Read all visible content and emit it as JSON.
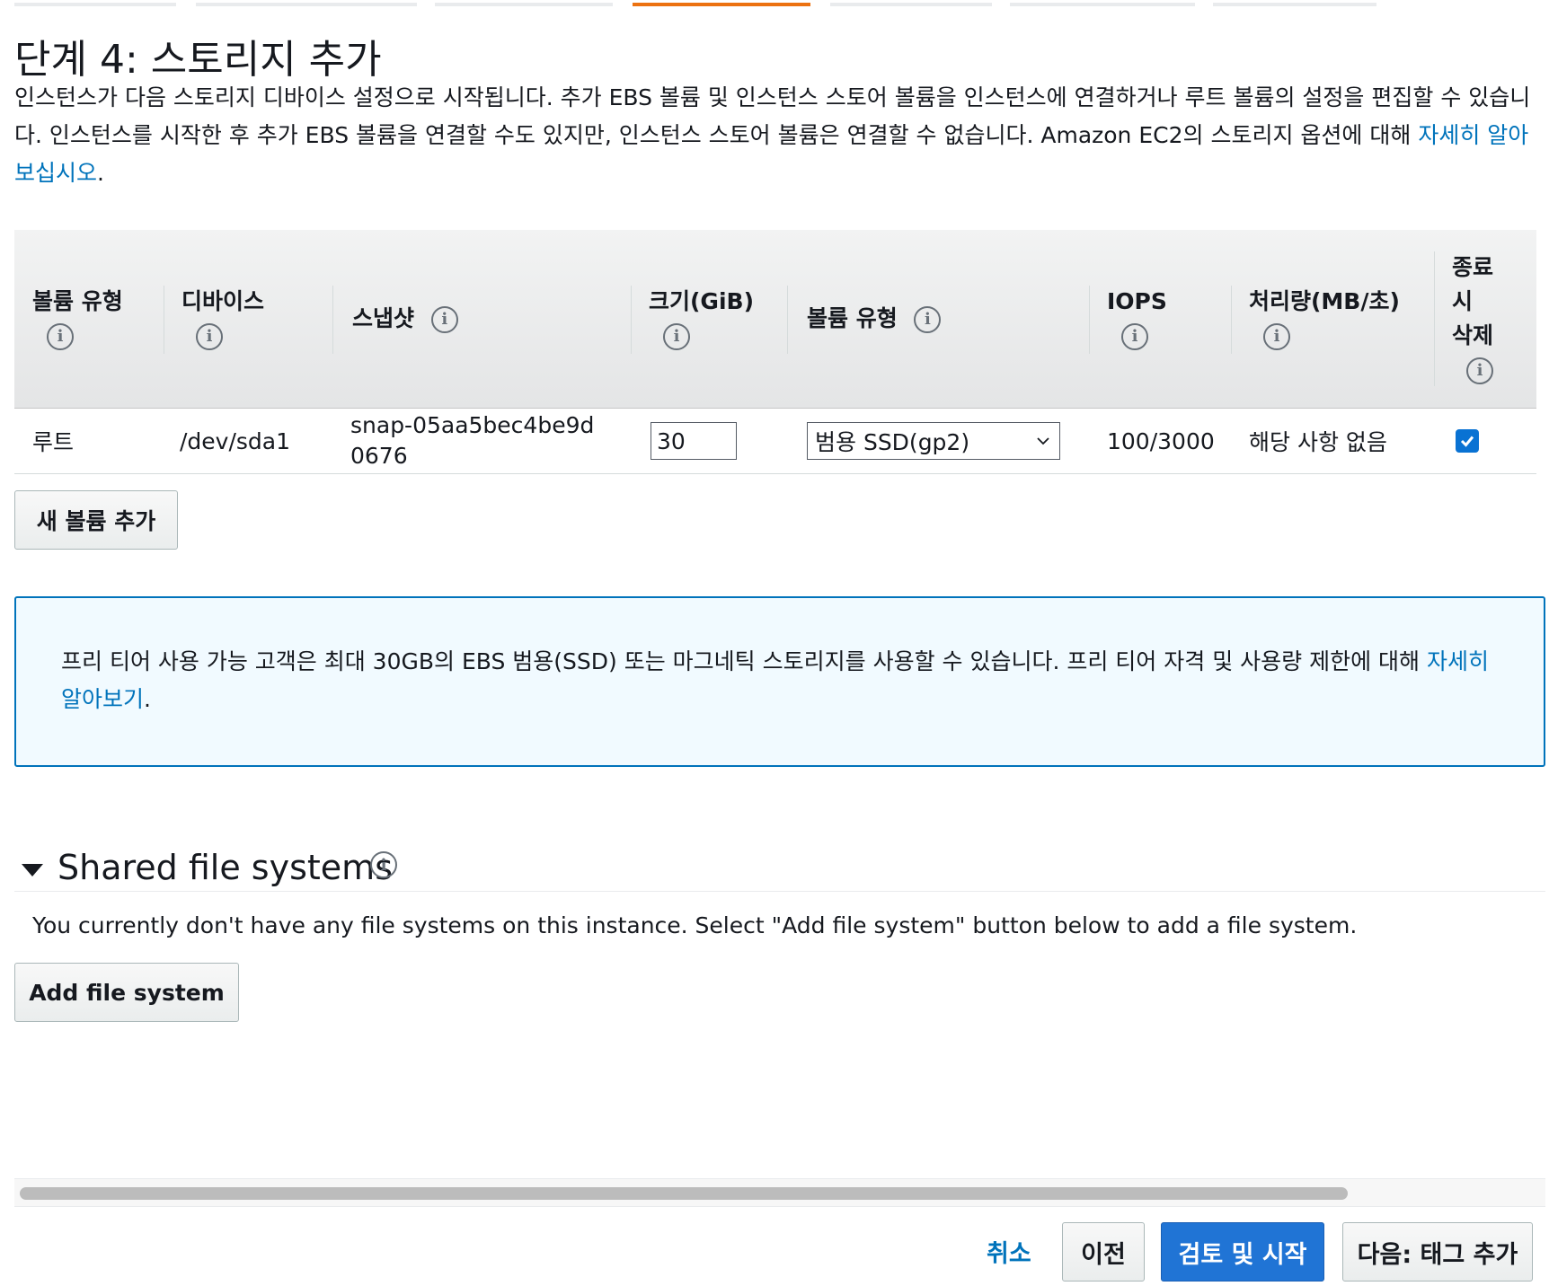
{
  "wizard": {
    "step_count": 7,
    "active_step": 4
  },
  "page": {
    "title": "단계 4: 스토리지 추가",
    "description": "인스턴스가 다음 스토리지 디바이스 설정으로 시작됩니다. 추가 EBS 볼륨 및 인스턴스 스토어 볼륨을 인스턴스에 연결하거나 루트 볼륨의 설정을 편집할 수 있습니다. 인스턴스를 시작한 후 추가 EBS 볼륨을 연결할 수도 있지만, 인스턴스 스토어 볼륨은 연결할 수 없습니다. Amazon EC2의 스토리지 옵션에 대해",
    "learn_more_link": "자세히 알아보십시오",
    "description_end": "."
  },
  "table": {
    "headers": {
      "volume_type": "볼륨 유형",
      "device": "디바이스",
      "snapshot": "스냅샷",
      "size": "크기(GiB)",
      "ebs_volume_type": "볼륨 유형",
      "iops": "IOPS",
      "throughput": "처리량(MB/초)",
      "delete_on_termination": "종료 시 삭제"
    },
    "rows": [
      {
        "volume_type": "루트",
        "device": "/dev/sda1",
        "snapshot": "snap-05aa5bec4be9d0676",
        "size": "30",
        "ebs_volume_type": "범용 SSD(gp2)",
        "iops": "100/3000",
        "throughput": "해당 사항 없음",
        "delete_on_termination": true
      }
    ],
    "add_volume_button": "새 볼륨 추가"
  },
  "free_tier": {
    "text": "프리 티어 사용 가능 고객은 최대 30GB의 EBS 범용(SSD) 또는 마그네틱 스토리지를 사용할 수 있습니다. 프리 티어 자격 및 사용량 제한에 대해",
    "link": "자세히 알아보기",
    "end": "."
  },
  "shared_fs": {
    "title": "Shared file systems",
    "description": "You currently don't have any file systems on this instance. Select \"Add file system\" button below to add a file system.",
    "add_button": "Add file system"
  },
  "footer": {
    "cancel": "취소",
    "previous": "이전",
    "review_launch": "검토 및 시작",
    "next": "다음: 태그 추가"
  },
  "colors": {
    "accent": "#0073bb",
    "primary_button": "#2074d5",
    "active_step": "#ec7211",
    "info_box_bg": "#f1faff"
  },
  "icons": {
    "info": "info-icon",
    "dropdown": "chevron-down-icon",
    "checkbox": "checkmark-icon",
    "collapse": "caret-down-icon"
  }
}
